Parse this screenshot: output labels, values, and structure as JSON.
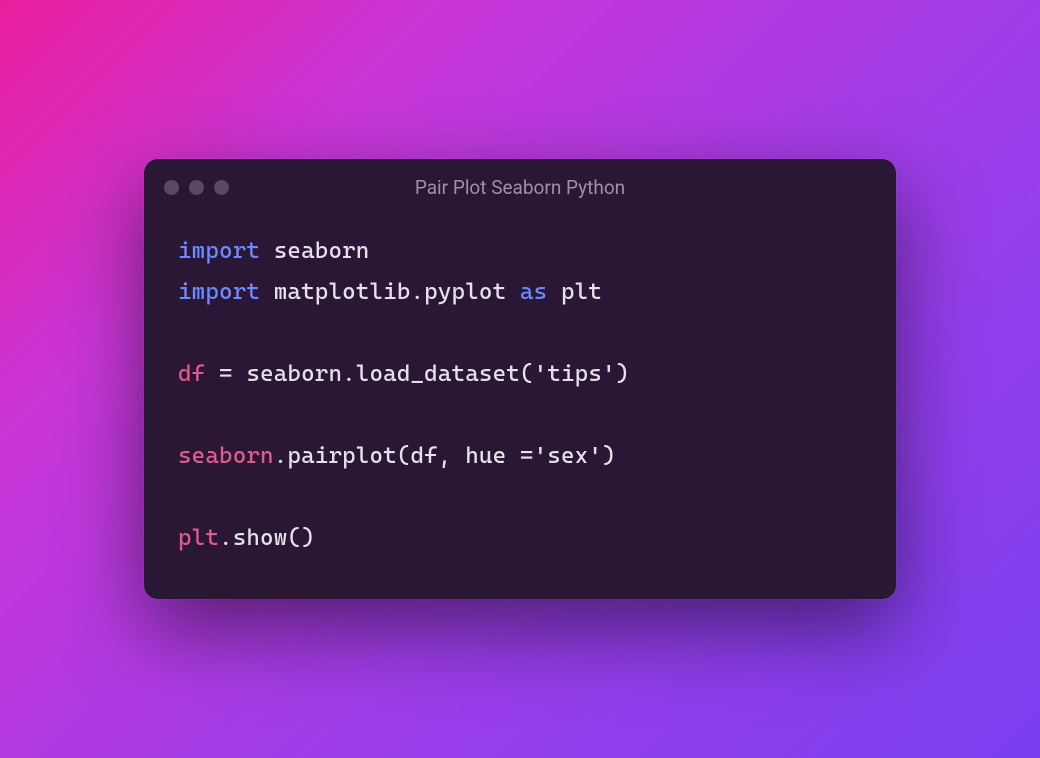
{
  "window": {
    "title": "Pair Plot Seaborn Python"
  },
  "code": {
    "kw_import_1": "import",
    "mod_seaborn": " seaborn",
    "kw_import_2": "import",
    "mod_matplotlib": " matplotlib.pyplot ",
    "kw_as": "as",
    "alias_plt": " plt",
    "var_df": "df",
    "assign_load": " = seaborn.load_dataset(",
    "str_tips": "'tips'",
    "close_paren_1": ")",
    "call_seaborn": "seaborn",
    "call_pairplot": ".pairplot(df, hue =",
    "str_sex": "'sex'",
    "close_paren_2": ")",
    "var_plt": "plt",
    "call_show": ".show()"
  }
}
